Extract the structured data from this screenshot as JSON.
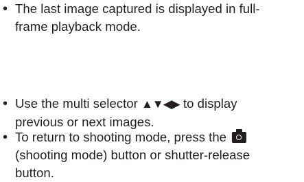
{
  "bullets": [
    {
      "lines": [
        "The last image captured is displayed in full-",
        "frame playback mode."
      ]
    },
    {
      "lines": [
        "Use the multi selector",
        "to display",
        "previous or next images."
      ],
      "icon": "multi-selector-arrows-icon",
      "arrow_glyphs": "▲▼◀▶"
    },
    {
      "lines": [
        "To return to shooting mode, press the",
        "(shooting mode) button or shutter-release",
        "button."
      ],
      "icon": "camera-icon"
    }
  ],
  "colors": {
    "text": "#231f20",
    "background": "#ffffff"
  }
}
